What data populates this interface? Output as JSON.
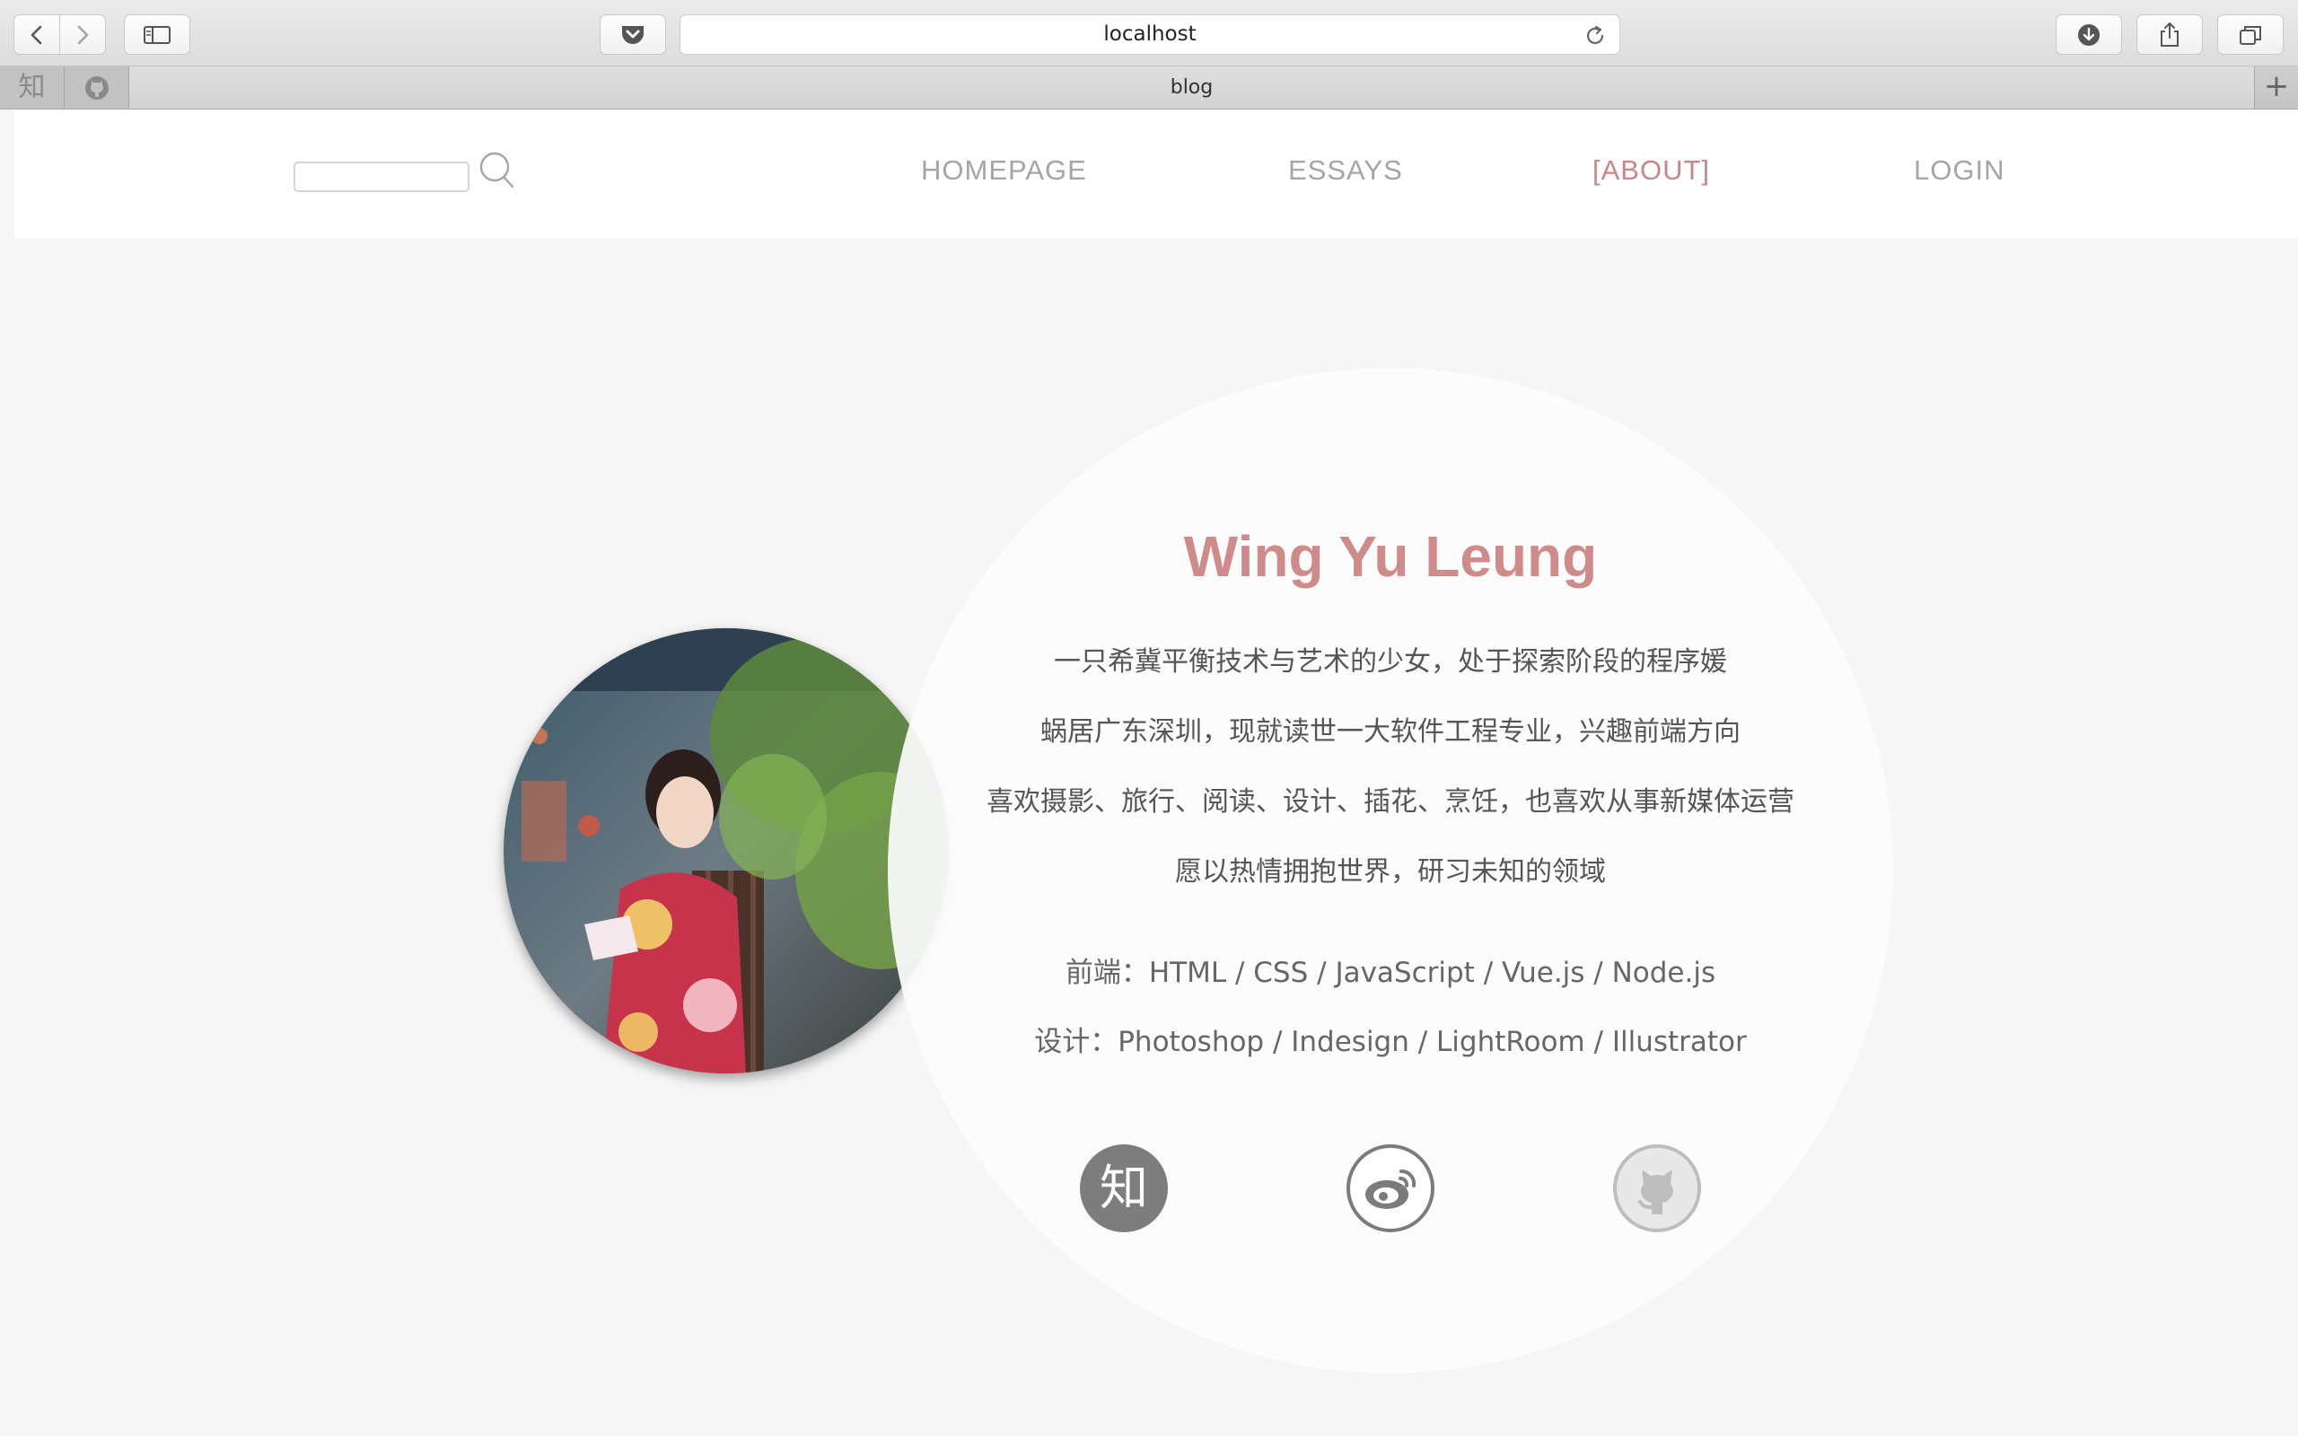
{
  "browser": {
    "url": "localhost",
    "tab_title": "blog",
    "pinned_tabs": [
      {
        "name": "zhihu",
        "glyph": "知"
      },
      {
        "name": "github",
        "icon": "github-icon"
      }
    ],
    "new_tab_glyph": "+"
  },
  "header": {
    "search": {
      "placeholder": "",
      "value": ""
    },
    "nav": [
      {
        "label": "HOMEPAGE",
        "active": false
      },
      {
        "label": "ESSAYS",
        "active": false
      },
      {
        "label": "[ABOUT]",
        "active": true
      },
      {
        "label": "LOGIN",
        "active": false
      }
    ]
  },
  "profile": {
    "name": "Wing Yu Leung",
    "bio": [
      "一只希冀平衡技术与艺术的少女，处于探索阶段的程序媛",
      "蜗居广东深圳，现就读世一大软件工程专业，兴趣前端方向",
      "喜欢摄影、旅行、阅读、设计、插花、烹饪，也喜欢从事新媒体运营",
      "愿以热情拥抱世界，研习未知的领域"
    ],
    "skills": [
      "前端：HTML / CSS / JavaScript / Vue.js / Node.js",
      "设计：Photoshop / Indesign / LightRoom / Illustrator"
    ],
    "social": [
      {
        "name": "zhihu",
        "glyph": "知",
        "icon": "zhihu-icon"
      },
      {
        "name": "weibo",
        "icon": "weibo-icon"
      },
      {
        "name": "github",
        "icon": "github-icon"
      }
    ]
  },
  "colors": {
    "accent": "#cf8b89",
    "nav_inactive": "#a5a5a5",
    "page_bg": "#f6f6f6",
    "text": "#555555"
  }
}
